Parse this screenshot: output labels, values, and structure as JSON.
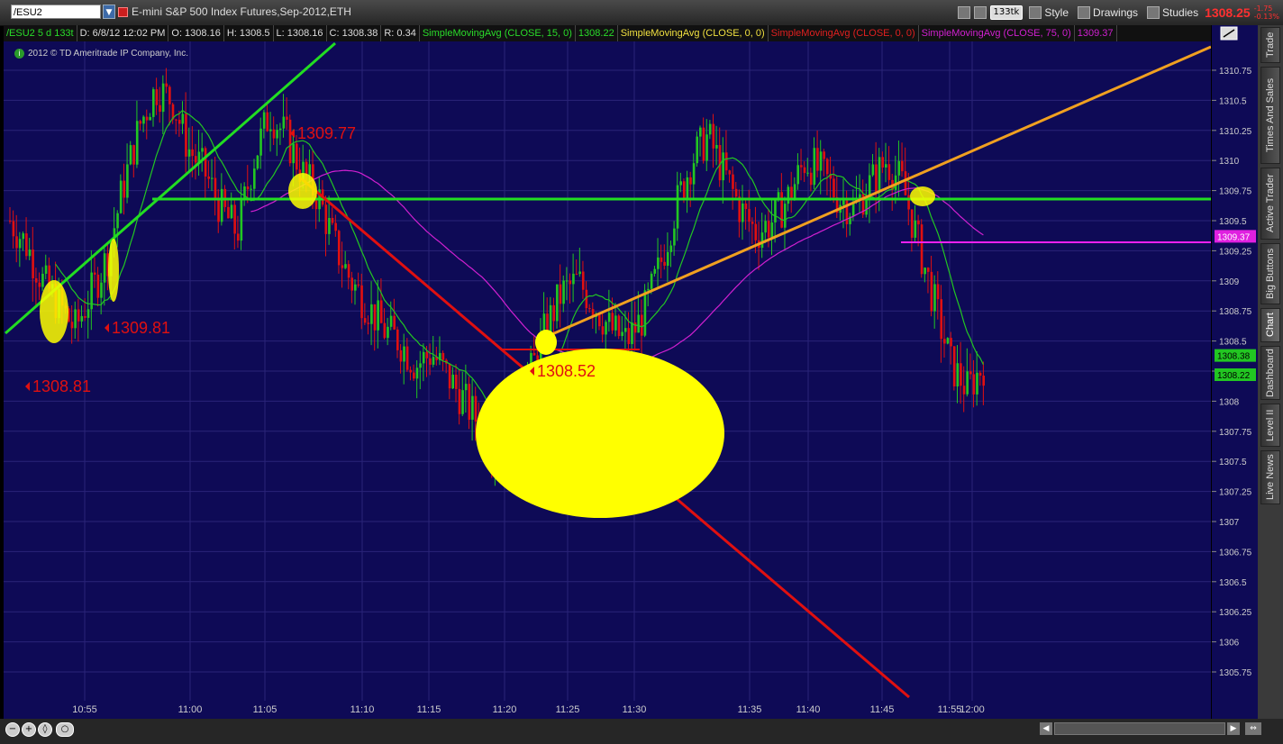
{
  "symbol": "/ESU2",
  "description": "E-mini S&P 500 Index Futures,Sep-2012,ETH",
  "toolbar": {
    "tick_label": "133tk",
    "style_label": "Style",
    "drawings_label": "Drawings",
    "studies_label": "Studies",
    "last_price": "1308.25",
    "change": "-1.75",
    "change_pct": "-0.13%"
  },
  "info_bar": {
    "sym": "/ESU2 5 d 133t",
    "date": "D: 6/8/12 12:02 PM",
    "open": "O: 1308.16",
    "high": "H: 1308.5",
    "low": "L: 1308.16",
    "close": "C: 1308.38",
    "range": "R: 0.34",
    "sma15_label": "SimpleMovingAvg (CLOSE, 15, 0)",
    "sma15_val": "1308.22",
    "sma_a_label": "SimpleMovingAvg (CLOSE, 0, 0)",
    "sma_b_label": "SimpleMovingAvg (CLOSE, 0, 0)",
    "sma75_label": "SimpleMovingAvg (CLOSE, 75, 0)",
    "sma75_val": "1309.37"
  },
  "copyright": "2012 © TD Ameritrade IP Company, Inc.",
  "annotations": {
    "a1": "1309.77",
    "a2": "1309.81",
    "a3": "1308.81",
    "a4": "1308.52"
  },
  "colors": {
    "background": "#0e0a56",
    "up_bar": "#22c622",
    "down_bar": "#e01010",
    "sma15": "#22c622",
    "sma75": "#d020d0",
    "trend_up": "#22dd22",
    "trend_down": "#e01010",
    "trend_orange": "#f0a020",
    "highlight": "#ffff00"
  },
  "side_tabs": [
    "Trade",
    "Times And Sales",
    "Active Trader",
    "Big Buttons",
    "Chart",
    "Dashboard",
    "Level II",
    "Live News"
  ],
  "price_labels": {
    "sma75": "1309.37",
    "close": "1308.38",
    "sma15": "1308.22"
  },
  "chart_data": {
    "type": "candlestick",
    "y_ticks": [
      1310.75,
      1310.5,
      1310.25,
      1310,
      1309.75,
      1309.5,
      1309.25,
      1309,
      1308.75,
      1308.5,
      1308.25,
      1308,
      1307.75,
      1307.5,
      1307.25,
      1307,
      1306.75,
      1306.5,
      1306.25,
      1306,
      1305.75
    ],
    "ylim": [
      1305.5,
      1311.0
    ],
    "x_ticks": [
      "10:55",
      "11:00",
      "11:05",
      "11:10",
      "11:15",
      "11:20",
      "11:25",
      "11:30",
      "11:35",
      "11:40",
      "11:45",
      "11:55",
      "12:00"
    ],
    "horizontal_lines": [
      {
        "value": 1309.68,
        "color": "#22dd22"
      },
      {
        "value": 1309.32,
        "color": "#ee20ee"
      }
    ],
    "price_path": [
      1309.5,
      1309.3,
      1309.0,
      1308.8,
      1308.6,
      1308.9,
      1309.2,
      1309.8,
      1310.3,
      1310.6,
      1310.5,
      1310.1,
      1309.9,
      1309.6,
      1309.4,
      1310.0,
      1310.4,
      1310.2,
      1309.9,
      1309.7,
      1309.3,
      1309.0,
      1308.8,
      1308.6,
      1308.5,
      1308.3,
      1308.4,
      1308.2,
      1308.0,
      1307.8,
      1307.6,
      1307.8,
      1308.2,
      1308.6,
      1308.9,
      1309.0,
      1308.8,
      1308.6,
      1308.5,
      1308.7,
      1309.1,
      1309.6,
      1310.0,
      1310.2,
      1309.9,
      1309.6,
      1309.4,
      1309.5,
      1309.7,
      1310.0,
      1309.9,
      1309.7,
      1309.6,
      1309.8,
      1310.0,
      1309.8,
      1309.3,
      1308.8,
      1308.3,
      1308.1,
      1308.3
    ]
  }
}
